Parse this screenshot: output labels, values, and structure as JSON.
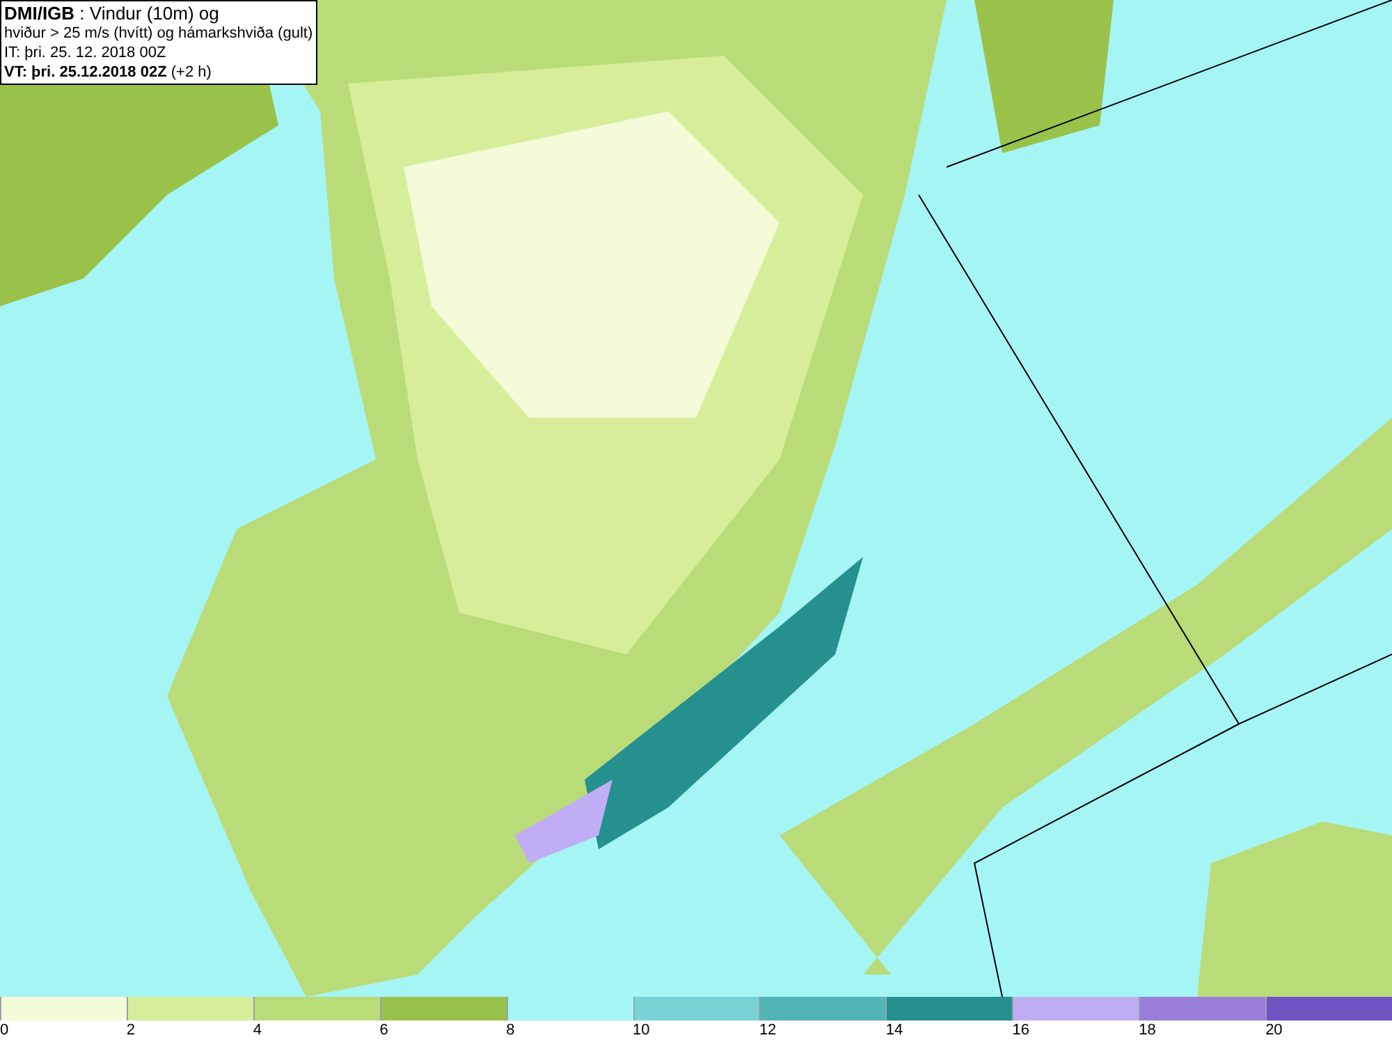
{
  "header": {
    "lines": [
      "**DMI/IGB** : Vindur (10m) og",
      "hviður > 25 m/s (hvítt) og hámarkshviða (gult)",
      "IT: þri. 25. 12. 2018 00Z",
      "**VT: þri. 25.12.2018 02Z** (+2 h)"
    ]
  },
  "legend": {
    "bins": [
      {
        "label": "0",
        "color": "#f3fbd9"
      },
      {
        "label": "2",
        "color": "#d6ee9a"
      },
      {
        "label": "4",
        "color": "#b9dc78"
      },
      {
        "label": "6",
        "color": "#99c24a"
      },
      {
        "label": "8",
        "color": "#a5f5f5"
      },
      {
        "label": "10",
        "color": "#78d4d4"
      },
      {
        "label": "12",
        "color": "#52b5b5"
      },
      {
        "label": "14",
        "color": "#26908f"
      },
      {
        "label": "16",
        "color": "#c0aef5"
      },
      {
        "label": "18",
        "color": "#9a7ed8"
      },
      {
        "label": "20",
        "color": "#7153c4"
      }
    ]
  }
}
